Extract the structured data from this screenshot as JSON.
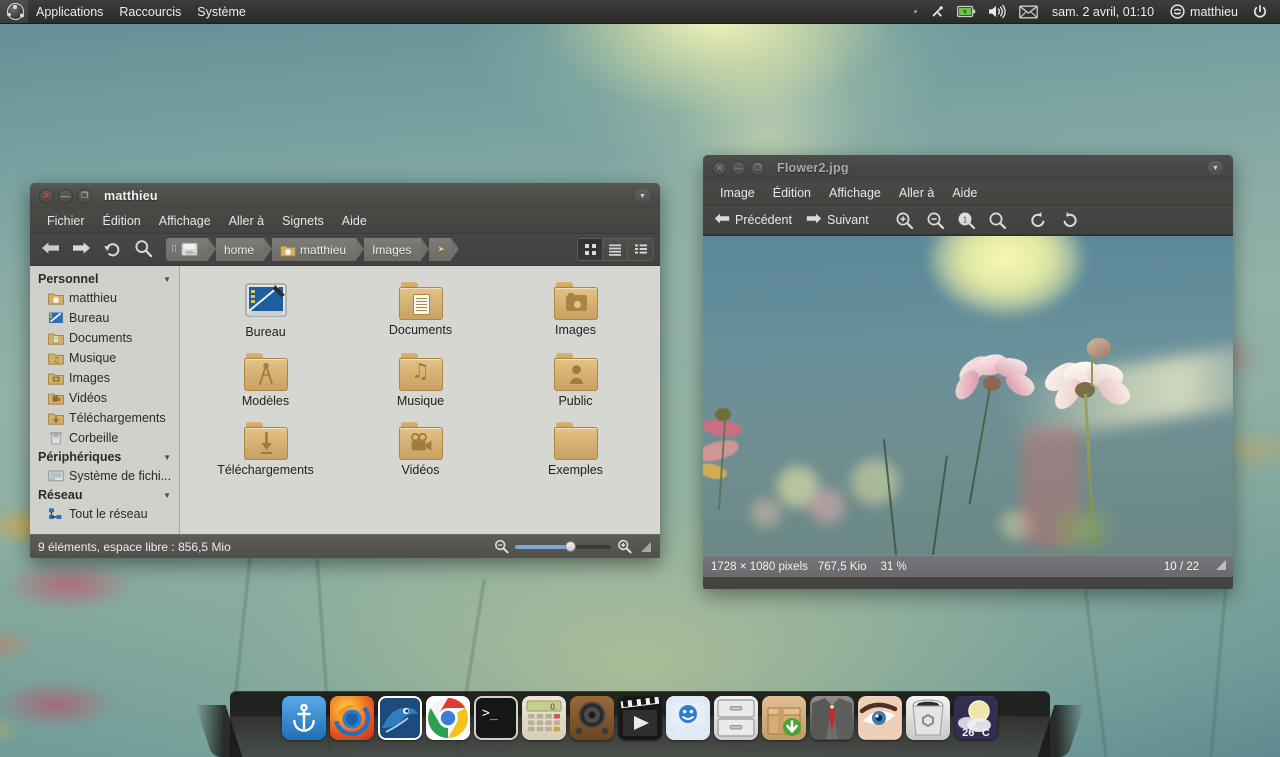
{
  "panel": {
    "logo_icon": "ubuntu-logo-icon",
    "menus": [
      "Applications",
      "Raccourcis",
      "Système"
    ],
    "tray": [
      {
        "name": "bluetooth-icon",
        "label": ""
      },
      {
        "name": "battery-icon",
        "label": ""
      },
      {
        "name": "volume-icon",
        "label": ""
      },
      {
        "name": "mail-icon",
        "label": ""
      }
    ],
    "clock": "sam. 2 avril, 01:10",
    "user": "matthieu",
    "user_icon": "messaging-icon",
    "power_icon": "power-icon"
  },
  "file_manager": {
    "title": "matthieu",
    "window_buttons": {
      "close": "✕",
      "minimize": "—",
      "maximize": "❐"
    },
    "menus": [
      "Fichier",
      "Édition",
      "Affichage",
      "Aller à",
      "Signets",
      "Aide"
    ],
    "toolbar": {
      "back_icon": "back-arrow-icon",
      "forward_icon": "forward-arrow-icon",
      "reload_icon": "reload-icon",
      "search_icon": "search-icon"
    },
    "breadcrumbs": [
      {
        "label": "",
        "icon": "drive-icon"
      },
      {
        "label": "home",
        "icon": ""
      },
      {
        "label": "matthieu",
        "icon": "home-folder-icon"
      },
      {
        "label": "Images",
        "icon": ""
      }
    ],
    "view_buttons": [
      {
        "name": "icon-view",
        "selected": true
      },
      {
        "name": "list-view",
        "selected": false
      },
      {
        "name": "compact-view",
        "selected": false
      }
    ],
    "sidebar": [
      {
        "type": "header",
        "label": "Personnel"
      },
      {
        "type": "item",
        "label": "matthieu",
        "icon": "home-folder-icon"
      },
      {
        "type": "item",
        "label": "Bureau",
        "icon": "desktop-icon"
      },
      {
        "type": "item",
        "label": "Documents",
        "icon": "documents-folder-icon"
      },
      {
        "type": "item",
        "label": "Musique",
        "icon": "music-folder-icon"
      },
      {
        "type": "item",
        "label": "Images",
        "icon": "pictures-folder-icon"
      },
      {
        "type": "item",
        "label": "Vidéos",
        "icon": "videos-folder-icon"
      },
      {
        "type": "item",
        "label": "Téléchargements",
        "icon": "downloads-folder-icon"
      },
      {
        "type": "item",
        "label": "Corbeille",
        "icon": "trash-icon"
      },
      {
        "type": "header",
        "label": "Périphériques"
      },
      {
        "type": "item",
        "label": "Système de fichi...",
        "icon": "filesystem-icon"
      },
      {
        "type": "header",
        "label": "Réseau"
      },
      {
        "type": "item",
        "label": "Tout le réseau",
        "icon": "network-icon"
      }
    ],
    "files": [
      {
        "label": "Bureau",
        "icon": "desktop-icon",
        "kind": "desktop"
      },
      {
        "label": "Documents",
        "icon": "documents-folder-icon",
        "kind": "folder",
        "glyph": "▤"
      },
      {
        "label": "Images",
        "icon": "pictures-folder-icon",
        "kind": "folder",
        "glyph": "▣"
      },
      {
        "label": "Modèles",
        "icon": "templates-folder-icon",
        "kind": "folder",
        "glyph": "△"
      },
      {
        "label": "Musique",
        "icon": "music-folder-icon",
        "kind": "folder",
        "glyph": "♫"
      },
      {
        "label": "Public",
        "icon": "public-folder-icon",
        "kind": "folder",
        "glyph": "♟"
      },
      {
        "label": "Téléchargements",
        "icon": "downloads-folder-icon",
        "kind": "folder",
        "glyph": "⇓"
      },
      {
        "label": "Vidéos",
        "icon": "videos-folder-icon",
        "kind": "folder",
        "glyph": "🎥"
      },
      {
        "label": "Exemples",
        "icon": "folder-icon",
        "kind": "folder",
        "glyph": ""
      }
    ],
    "status": "9 éléments, espace libre : 856,5 Mio",
    "zoom": {
      "out_icon": "zoom-out-icon",
      "in_icon": "zoom-in-icon",
      "value": 52
    }
  },
  "image_viewer": {
    "title": "Flower2.jpg",
    "menus": [
      "Image",
      "Édition",
      "Affichage",
      "Aller à",
      "Aide"
    ],
    "toolbar": {
      "previous": "Précédent",
      "next": "Suivant",
      "previous_icon": "back-arrow-icon",
      "next_icon": "forward-arrow-icon",
      "buttons": [
        {
          "name": "zoom-in-icon"
        },
        {
          "name": "zoom-out-icon"
        },
        {
          "name": "normal-size-icon"
        },
        {
          "name": "best-fit-icon"
        },
        {
          "name": "rotate-left-icon"
        },
        {
          "name": "rotate-right-icon"
        }
      ]
    },
    "status": {
      "dimensions": "1728 × 1080 pixels",
      "filesize": "767,5 Kio",
      "zoom": "31 %",
      "position": "10 / 22"
    }
  },
  "dock": {
    "items": [
      {
        "name": "dock-item-docky",
        "icon": "anchor-icon"
      },
      {
        "name": "dock-item-firefox",
        "icon": "firefox-icon"
      },
      {
        "name": "dock-item-thunderbird",
        "icon": "mail-stamp-icon"
      },
      {
        "name": "dock-item-chrome",
        "icon": "chrome-icon"
      },
      {
        "name": "dock-item-terminal",
        "icon": "terminal-icon"
      },
      {
        "name": "dock-item-calculator",
        "icon": "calculator-icon"
      },
      {
        "name": "dock-item-rhythmbox",
        "icon": "speaker-icon"
      },
      {
        "name": "dock-item-movieplayer",
        "icon": "film-play-icon"
      },
      {
        "name": "dock-item-empathy",
        "icon": "chat-bubble-icon"
      },
      {
        "name": "dock-item-filecabinet",
        "icon": "file-cabinet-icon"
      },
      {
        "name": "dock-item-updatemanager",
        "icon": "package-download-icon"
      },
      {
        "name": "dock-item-suit",
        "icon": "suit-tie-icon"
      },
      {
        "name": "dock-item-eye",
        "icon": "eye-icon"
      },
      {
        "name": "dock-item-trash",
        "icon": "recycle-bin-icon"
      },
      {
        "name": "dock-item-weather",
        "icon": "weather-icon",
        "label": "26° C"
      }
    ]
  },
  "colors": {
    "panel_bg": "#333331",
    "window_chrome": "#474744",
    "sidebar_bg": "#d0d0cc",
    "content_bg": "#d6d6d2",
    "folder": "#d8b478",
    "accent": "#7fa8d8"
  }
}
